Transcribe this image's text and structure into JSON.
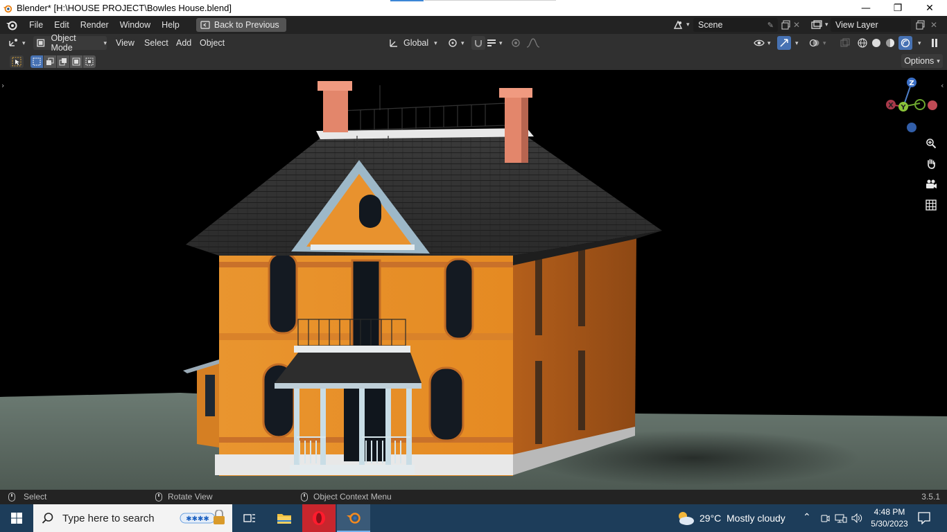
{
  "window": {
    "title": "Blender* [H:\\HOUSE PROJECT\\Bowles House.blend]",
    "controls": {
      "minimize": "—",
      "maximize": "❐",
      "close": "✕"
    }
  },
  "menubar": {
    "items": [
      "File",
      "Edit",
      "Render",
      "Window",
      "Help"
    ],
    "back_button": "Back to Previous",
    "scene_label": "Scene",
    "view_layer_label": "View Layer"
  },
  "header": {
    "mode": "Object Mode",
    "menus": [
      "View",
      "Select",
      "Add",
      "Object"
    ],
    "transform_orientation": "Global",
    "options": "Options"
  },
  "statusbar": {
    "select": "Select",
    "rotate": "Rotate View",
    "context": "Object Context Menu",
    "version": "3.5.1"
  },
  "gizmo": {
    "z": "Z",
    "y": "Y",
    "x": "X"
  },
  "taskbar": {
    "search_placeholder": "Type here to search",
    "weather_temp": "29°C",
    "weather_desc": "Mostly cloudy",
    "time": "4:48 PM",
    "date": "5/30/2023"
  },
  "colors": {
    "accent": "#4772b3",
    "house_wall": "#e8922e",
    "roof": "#2b2b2b",
    "trim": "#9db8c8",
    "chimney": "#e8846a",
    "ground": "#5c6a62"
  }
}
